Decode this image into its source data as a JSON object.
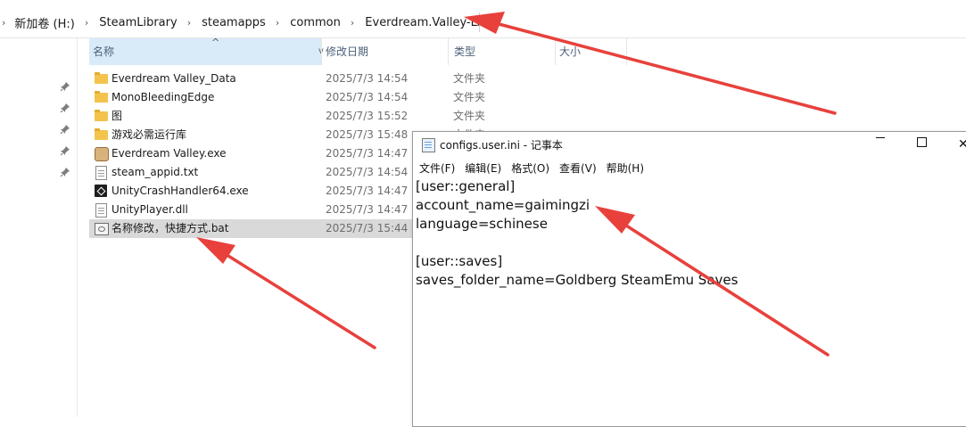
{
  "explorer": {
    "breadcrumb": [
      {
        "label": "新加卷 (H:)"
      },
      {
        "label": "SteamLibrary"
      },
      {
        "label": "steamapps"
      },
      {
        "label": "common"
      },
      {
        "label": "Everdream.Valley-LAN"
      }
    ],
    "columns": {
      "name": "名称",
      "modified": "修改日期",
      "type": "类型",
      "size": "大小"
    },
    "files": [
      {
        "name": "Everdream Valley_Data",
        "modified": "2025/7/3 14:54",
        "type": "文件夹",
        "icon": "folder-icon"
      },
      {
        "name": "MonoBleedingEdge",
        "modified": "2025/7/3 14:54",
        "type": "文件夹",
        "icon": "folder-icon"
      },
      {
        "name": "图",
        "modified": "2025/7/3 15:52",
        "type": "文件夹",
        "icon": "folder-icon"
      },
      {
        "name": "游戏必需运行库",
        "modified": "2025/7/3 15:48",
        "type": "文件夹",
        "icon": "folder-icon"
      },
      {
        "name": "Everdream Valley.exe",
        "modified": "2025/7/3 14:47",
        "type": "",
        "icon": "game-exe-icon"
      },
      {
        "name": "steam_appid.txt",
        "modified": "2025/7/3 14:54",
        "type": "",
        "icon": "text-file-icon"
      },
      {
        "name": "UnityCrashHandler64.exe",
        "modified": "2025/7/3 14:47",
        "type": "",
        "icon": "unity-exe-icon"
      },
      {
        "name": "UnityPlayer.dll",
        "modified": "2025/7/3 14:47",
        "type": "",
        "icon": "dll-file-icon"
      },
      {
        "name": "名称修改，快捷方式.bat",
        "modified": "2025/7/3 15:44",
        "type": "",
        "icon": "bat-file-icon",
        "selected": true
      }
    ]
  },
  "notepad": {
    "title": "configs.user.ini - 记事本",
    "menu": [
      "文件(F)",
      "编辑(E)",
      "格式(O)",
      "查看(V)",
      "帮助(H)"
    ],
    "lines": [
      "[user::general]",
      "account_name=gaimingzi",
      "language=schinese",
      "",
      "[user::saves]",
      "saves_folder_name=Goldberg SteamEmu Saves"
    ]
  },
  "colors": {
    "arrow": "#e8413c",
    "selection": "#d9d9d9",
    "header_highlight": "#d9ebf9",
    "folder": "#f3c34c"
  }
}
